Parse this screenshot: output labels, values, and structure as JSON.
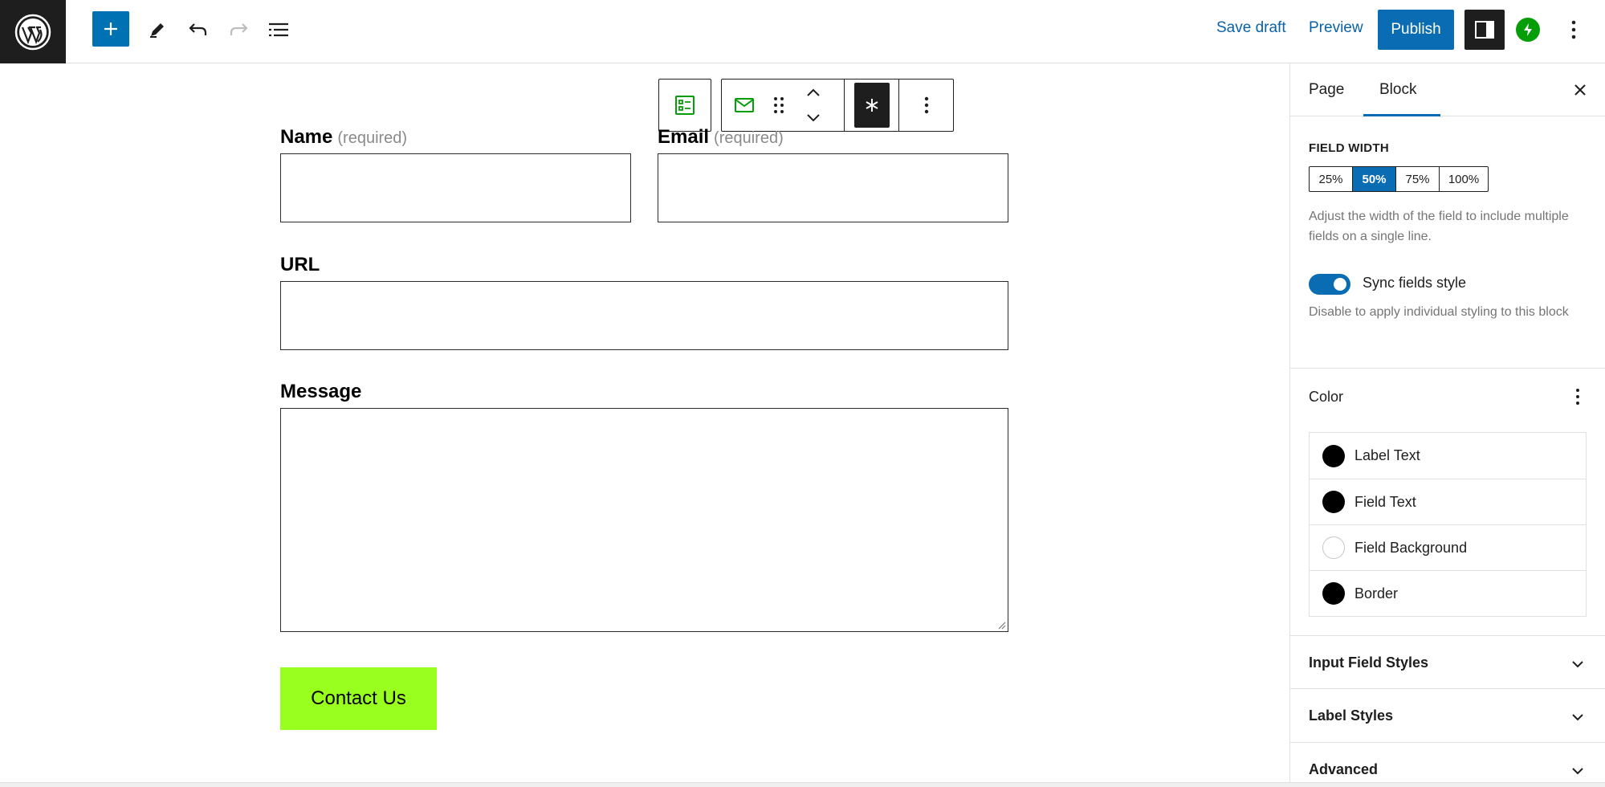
{
  "topbar": {
    "save_draft": "Save draft",
    "preview": "Preview",
    "publish": "Publish"
  },
  "form": {
    "name_label": "Name",
    "name_required": "(required)",
    "email_label": "Email",
    "email_required": "(required)",
    "url_label": "URL",
    "message_label": "Message",
    "submit_label": "Contact Us"
  },
  "sidebar": {
    "tabs": [
      "Page",
      "Block"
    ],
    "active_tab": "Block",
    "field_width_title": "FIELD WIDTH",
    "field_width_options": [
      "25%",
      "50%",
      "75%",
      "100%"
    ],
    "field_width_selected": "50%",
    "field_width_help": "Adjust the width of the field to include multiple fields on a single line.",
    "sync_label": "Sync fields style",
    "sync_enabled": true,
    "sync_help": "Disable to apply individual styling to this block",
    "color_title": "Color",
    "color_items": [
      {
        "label": "Label Text",
        "color": "#000000"
      },
      {
        "label": "Field Text",
        "color": "#000000"
      },
      {
        "label": "Field Background",
        "color": "#ffffff"
      },
      {
        "label": "Border",
        "color": "#000000"
      }
    ],
    "panels": [
      "Input Field Styles",
      "Label Styles",
      "Advanced"
    ]
  },
  "colors": {
    "accent": "#0a6db3",
    "button_bg": "#99ff1e",
    "jetpack": "#069e08"
  }
}
